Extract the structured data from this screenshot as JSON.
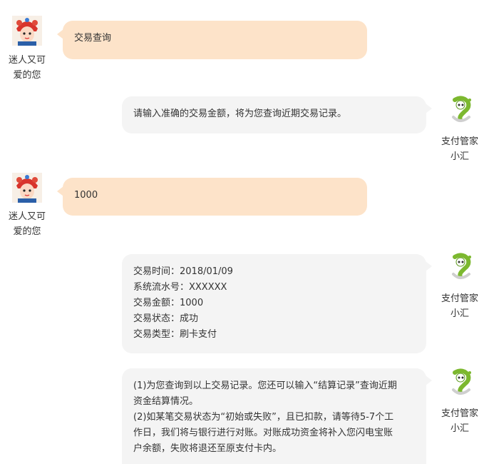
{
  "user": {
    "name_line1": "迷人又可",
    "name_line2": "爱的您",
    "avatar_icon": "opera-mask-avatar-icon"
  },
  "bot": {
    "name_line1": "支付管家",
    "name_line2": "小汇",
    "avatar_icon": "green-robot-avatar-icon"
  },
  "messages": [
    {
      "from": "user",
      "text": "交易查询"
    },
    {
      "from": "bot",
      "text": "请输入准确的交易金额，将为您查询近期交易记录。"
    },
    {
      "from": "user",
      "text": "1000"
    },
    {
      "from": "bot",
      "lines": [
        "交易时间：2018/01/09",
        "系统流水号：XXXXXX",
        "交易金额：1000",
        "交易状态：成功",
        "交易类型：刷卡支付"
      ]
    },
    {
      "from": "bot",
      "lines": [
        "(1)为您查询到以上交易记录。您还可以输入“结算记录”查询近期",
        "资金结算情况。",
        "(2)如某笔交易状态为“初始或失败”，且已扣款，请等待5-7个工",
        "作日，我们将与银行进行对账。对账成功资金将补入您闪电宝账",
        "户余额，失败将退还至原支付卡内。"
      ]
    }
  ],
  "colors": {
    "user_bubble": "#fde3c9",
    "bot_bubble": "#f4f4f4",
    "robot_green": "#7cb82f"
  }
}
